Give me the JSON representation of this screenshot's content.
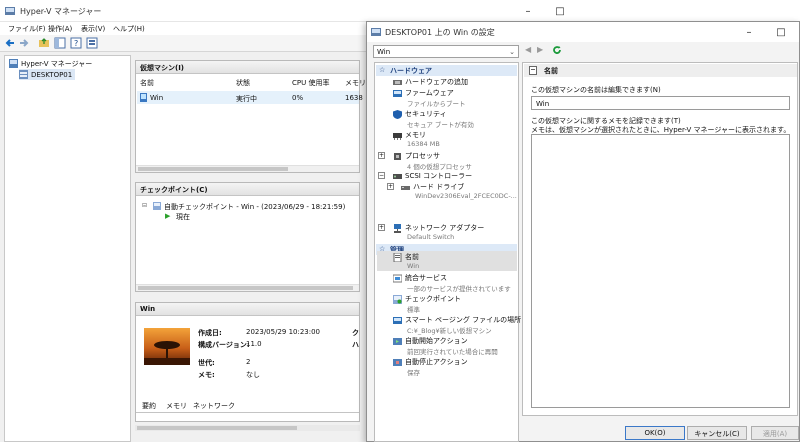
{
  "manager": {
    "title": "Hyper-V マネージャー",
    "menu": [
      "ファイル(F)",
      "操作(A)",
      "表示(V)",
      "ヘルプ(H)"
    ],
    "tree": {
      "root": "Hyper-V マネージャー",
      "host": "DESKTOP01"
    },
    "vm_panel": {
      "title": "仮想マシン(I)",
      "columns": [
        "名前",
        "状態",
        "CPU 使用率",
        "メモリ"
      ],
      "rows": [
        {
          "name": "Win",
          "state": "実行中",
          "cpu": "0%",
          "mem": "1638"
        }
      ]
    },
    "checkpoint_panel": {
      "title": "チェックポイント(C)",
      "item": "自動チェックポイント - Win - (2023/06/29 - 18:21:59)",
      "now": "現在"
    },
    "detail_panel": {
      "title": "Win",
      "labels": [
        "作成日:",
        "構成バージョン:",
        "世代:",
        "メモ:"
      ],
      "values": [
        "2023/05/29 10:23:00",
        "11.0",
        "2",
        "なし"
      ],
      "extra_right": [
        "ク",
        "ハ"
      ],
      "tabs": [
        "要約",
        "メモリ",
        "ネットワーク"
      ]
    }
  },
  "dialog": {
    "title": "DESKTOP01 上の Win の設定",
    "vm_select": "Win",
    "sections": {
      "hardware": "ハードウェア",
      "management": "管理"
    },
    "hardware_items": [
      {
        "label": "ハードウェアの追加",
        "sub": ""
      },
      {
        "label": "ファームウェア",
        "sub": "ファイルからブート"
      },
      {
        "label": "セキュリティ",
        "sub": "セキュア ブートが有効"
      },
      {
        "label": "メモリ",
        "sub": "16384 MB"
      },
      {
        "label": "プロセッサ",
        "sub": "4 個の仮想プロセッサ"
      },
      {
        "label": "SCSI コントローラー",
        "sub": ""
      },
      {
        "label": "ハード ドライブ",
        "sub": "WinDev2306Eval_2FCEC0DC-..."
      },
      {
        "label": "ネットワーク アダプター",
        "sub": "Default Switch"
      }
    ],
    "management_items": [
      {
        "label": "名前",
        "sub": "Win"
      },
      {
        "label": "統合サービス",
        "sub": "一部のサービスが提供されています"
      },
      {
        "label": "チェックポイント",
        "sub": "標準"
      },
      {
        "label": "スマート ページング ファイルの場所",
        "sub": "C:¥_Blog¥新しい仮想マシン"
      },
      {
        "label": "自動開始アクション",
        "sub": "前回実行されていた場合に再開"
      },
      {
        "label": "自動停止アクション",
        "sub": "保存"
      }
    ],
    "detail": {
      "header": "名前",
      "name_label": "この仮想マシンの名前は編集できます(N)",
      "name_value": "Win",
      "notes_label_1": "この仮想マシンに関するメモを記録できます(T)",
      "notes_label_2": "メモは、仮想マシンが選択されたときに、Hyper-V マネージャーに表示されます。"
    },
    "buttons": {
      "ok": "OK(O)",
      "cancel": "キャンセル(C)",
      "apply": "適用(A)"
    }
  },
  "colors": {
    "accent": "#0078d4",
    "section_bg": "#dde9f7",
    "running_green": "#2aa02a"
  }
}
